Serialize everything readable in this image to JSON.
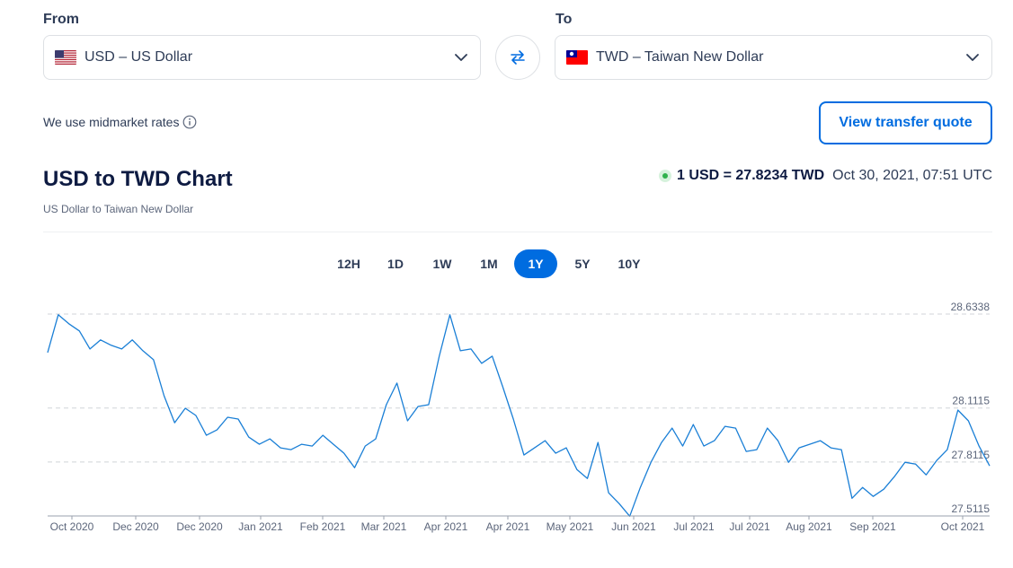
{
  "from": {
    "label": "From",
    "value": "USD – US Dollar",
    "flag_icon": "us-flag-icon"
  },
  "to": {
    "label": "To",
    "value": "TWD – Taiwan New Dollar",
    "flag_icon": "taiwan-flag-icon"
  },
  "swap_icon": "swap-arrows-icon",
  "midmarket_text": "We use midmarket rates",
  "quote_button": "View transfer quote",
  "chart_header": {
    "title": "USD to TWD Chart",
    "subtitle": "US Dollar to Taiwan New Dollar",
    "rate": "1 USD = 27.8234 TWD",
    "timestamp": "Oct 30, 2021, 07:51 UTC"
  },
  "ranges": [
    {
      "label": "12H",
      "active": false
    },
    {
      "label": "1D",
      "active": false
    },
    {
      "label": "1W",
      "active": false
    },
    {
      "label": "1M",
      "active": false
    },
    {
      "label": "1Y",
      "active": true
    },
    {
      "label": "5Y",
      "active": false
    },
    {
      "label": "10Y",
      "active": false
    }
  ],
  "colors": {
    "accent": "#006ce0",
    "line": "#1a7fd6",
    "gridline": "#d0d3d8",
    "live": "#2fb24c"
  },
  "chart_data": {
    "type": "line",
    "title": "USD to TWD Chart",
    "grid": "horizontal-dashed",
    "ylim": [
      27.5115,
      28.6338
    ],
    "y_ticks": [
      "28.6338",
      "28.1115",
      "27.8115",
      "27.5115"
    ],
    "x_tick_labels": [
      "Oct 2020",
      "Dec 2020",
      "Dec 2020",
      "Jan 2021",
      "Feb 2021",
      "Mar 2021",
      "Apr 2021",
      "Apr 2021",
      "May 2021",
      "Jun 2021",
      "Jul 2021",
      "Jul 2021",
      "Aug 2021",
      "Sep 2021",
      "Oct 2021"
    ],
    "series": [
      {
        "values": [
          28.42,
          28.63,
          28.58,
          28.54,
          28.44,
          28.49,
          28.46,
          28.44,
          28.49,
          28.43,
          28.38,
          28.18,
          28.03,
          28.11,
          28.07,
          27.96,
          27.99,
          28.06,
          28.05,
          27.95,
          27.91,
          27.94,
          27.89,
          27.88,
          27.91,
          27.9,
          27.96,
          27.91,
          27.86,
          27.78,
          27.9,
          27.94,
          28.13,
          28.25,
          28.04,
          28.12,
          28.13,
          28.4,
          28.63,
          28.43,
          28.44,
          28.36,
          28.4,
          28.23,
          28.05,
          27.85,
          27.89,
          27.93,
          27.86,
          27.89,
          27.77,
          27.72,
          27.92,
          27.64,
          27.58,
          27.51,
          27.67,
          27.81,
          27.92,
          28.0,
          27.9,
          28.02,
          27.9,
          27.93,
          28.01,
          28.0,
          27.87,
          27.88,
          28.0,
          27.93,
          27.81,
          27.89,
          27.91,
          27.93,
          27.89,
          27.88,
          27.61,
          27.67,
          27.62,
          27.66,
          27.73,
          27.81,
          27.8,
          27.74,
          27.82,
          27.88,
          28.1,
          28.04,
          27.9,
          27.79
        ]
      }
    ]
  }
}
